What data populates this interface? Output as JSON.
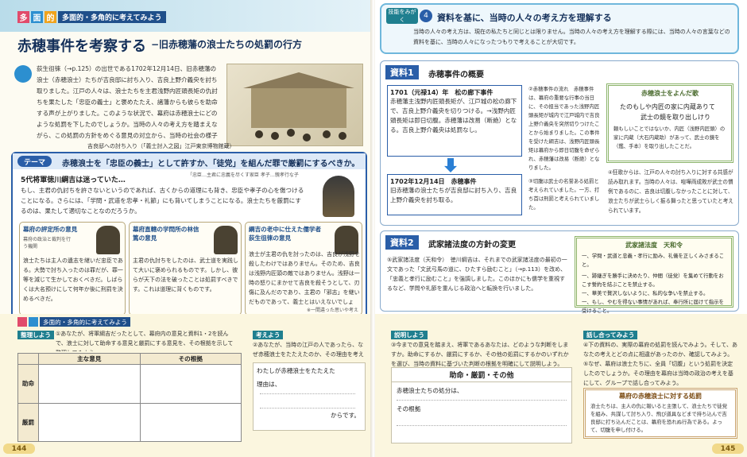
{
  "left": {
    "tag_label": "多面的・多角的に考えてみよう",
    "title": "赤穂事件を考察する",
    "subtitle": "−旧赤穂藩の浪士たちの処罰の行方",
    "intro_paragraph": "荻生徂徠（→p.125）の出世である1702年12月14日、旧赤穂藩の浪士（赤穂浪士）たちが吉良邸に討ち入り、吉良上野介義央を討ち取りました。江戸の人々は、浪士たちを主君浅野内匠頭長矩の仇討ちを果たした「忠臣の義士」と褒めたたえ、諸藩からも彼らを助命する声が上がりました。このような状況で、幕府は赤穂浪士にどのような処罰を下したのでしょうか。当時の人々の考え方を踏まえながら、この処罰の方針をめぐる意見の対立から、当時の社会の様子を多面的・多角的に考察してみよう。",
    "image_caption": "吉良邸への討ち入り（「義士討入之図」江戸東京博物館蔵）",
    "theme_label": "テーマ",
    "theme_text": "赤穂浪士を「忠臣の義士」として許すか、「徒党」を組んだ罪で厳罰にするべきか。",
    "opinion_main_title": "5代将軍徳川綱吉は迷っていた…",
    "opinion_main_text": "もし、主君の仇討ちを許さないというのであれば、古くからの道理にも背き、忠臣や孝子の心を傷つけることになる。さらには、「学問・武道を忠孝・礼節」にも背いてしまうことになる。浪士たちを厳罰にするのは、果たして適切なことなのだろうか。",
    "opinion_main_note": "「忠臣…主君に忠義を尽くす家臣 孝子…親孝行な子",
    "opinions": [
      {
        "name": "幕府の評定所の意見",
        "note": "幕府の政治と裁判を行う機関",
        "text": "浪士たちは主人の遺志を継いだ忠臣である。大勢で討ち入ったのは罪だが、罪一等を減じて生かしておくべきだ。しばらくは大名預けにして何年か後に刑罰を決めるべきだ。"
      },
      {
        "name": "幕府直轄の学問所の林信篤の意見",
        "note": "",
        "text": "主君の仇討ちをしたのは、武士道を実践して大いに褒められるものです。しかし、彼らが天下の法を破ったことは処罰すべきです。これは道理に背くものです。"
      },
      {
        "name": "綱吉の老中に仕えた儒学者荻生徂徠の意見",
        "note": "",
        "text": "浪士が主君の仇を討ったのは、吉良が浅野を殺したわけではありません。そのため、吉良は浅野内匠頭の敵ではありません。浅野は一時の怒りにまかせて吉良を殺そうとして、刃傷に及んだのであり、主君の「邪志」を継いだものであって、義士とはいえないでしょう。"
      }
    ],
    "opinion_footnote": "※一間違った思いや考え",
    "bottom_tag": "多面的・多角的に考えてみよう",
    "task1_label": "整理しよう",
    "task1_text": "①あなたが、将軍綱吉だったとして、幕府内の意見と資料1・2を読んで、浪士に対して助命する意見と厳罰にする意見を、その根拠を示して整理してみよう。",
    "table_headers": [
      "主な意見",
      "その根拠"
    ],
    "table_rows": [
      "助命",
      "厳罰"
    ],
    "task2_label": "考えよう",
    "task2_text": "②あなたが、当時の江戸の人であったら、なぜ赤穂浪士をたたえたのか、その理由を考えてみよう。",
    "fill_box_text1": "わたしが赤穂浪士をたたえた",
    "fill_box_text2": "理由は、",
    "fill_box_end": "からです。",
    "page_number": "144"
  },
  "right": {
    "skill_tag": "技能をみがく",
    "skill_number": "4",
    "skill_title": "資料を基に、当時の人々の考え方を理解する",
    "skill_text": "当時の人々の考え方は、現在の私たちと同じとは限りません。当時の人々の考え方を理解する際には、当時の人々の言葉などの資料を基に、当時の人々になったつもりで考えることが大切です。",
    "source1_label": "資料1",
    "source1_title": "赤穂事件の概要",
    "event1_date": "1701（元禄14）年　松の廊下事件",
    "event1_text": "赤穂藩主浅野内匠頭長矩が、江戸城の松の廊下で、吉良上野介義央を切りつける。→浅野内匠頭長矩は即日切腹。赤穂藩は改易（断絶）となる。吉良上野介義央は処罰なし。",
    "event2_date": "1702年12月14日　赤穂事件",
    "event2_text": "旧赤穂藩の浪士たちが吉良邸に討ち入り、吉良上野介義央を討ち取る。",
    "side_note1": "②赤穂事件の流れ　赤穂事件は、幕府の重要な行事の当日に、その担当であった浅野内匠頭長矩が城内で江戸城内で吉良上野介義央を突然切りつけたことから始まりました。この事件を受けた綱吉は、浅野内匠頭長矩は幕府から即日切腹を命ぜられ、赤穂藩は改易（断絶）となりました。",
    "side_note2": "③切腹は武士の名誉ある処罰と考えられていました。一方、打ち首は刑罰と考えられていました。",
    "poem_title": "赤穂浪士をよんだ歌",
    "poem_lines": [
      "たのもしや内匠の家に内蔵ありて",
      "武士の鏡を取り出しけり"
    ],
    "poem_note": "頼もしいことではないか、内匠（浅野内匠頭）の家に内蔵（大石内蔵助）があって、武士の鏡を（鑑、手本）を取り出したことだ。",
    "poem_desc": "④狂歌からは、江戸の人々の討ち入りに対する共感が読み取れます。当時の人々は、喧嘩両成敗が武士の慣例であるのに、吉良は切腹しなかったことに対して、浪士たちが武士らしく振る舞ったと思っていたと考えられています。",
    "source2_label": "資料2",
    "source2_title": "武家諸法度の方針の変更",
    "source2_text": "⑤武家諸法度（天和令）　徳川綱吉は、それまでの武家諸法度の最初の一文であった「文武弓馬の道に、ひたすら励むこと」（→p.113）を改め、「忠義と孝行に励むこと」を強調しました。このほかにも儒学を重視するなど、学問や礼節を重んじる政治へと転換を行いました。",
    "law_title": "武家諸法度",
    "law_sub": "天和令",
    "law_items": [
      "一、学問・武道と忠義・孝行に励み、礼儀を正しくみさまること。",
      "一、跡継ぎを勝手に決めたり、仲間（徒党）を集めて行動をおこす誓約を結ぶことを禁止する。",
      "一、華美で贅沢しないように、私的な争いを禁止する。",
      "一、もし、やむを得ない事情があれば、奉行所に届けて指示を受けること。"
    ],
    "task3_label": "説明しよう",
    "task3_text": "③今までの意見を踏まえ、将軍であるあなたは、どのような判断をしますか。助命にするか、厳罰にするか、その他の処罰にするかのいずれかを選び、当時の資料に基づいた判断の根拠を明確にして説明しよう。",
    "answer_header": "助命・厳罰・その他",
    "answer_line1": "赤穂浪士たちの処分は、",
    "answer_line2": "その根拠",
    "task4_label": "話し合ってみよう",
    "task4_text": "④下の資料の、実際の幕府の処罰を読んでみよう。そして、あなたの考えとどの点に相違があったのか、確認してみよう。⑤なぜ、幕府は浪士たちに、全員「切腹」という処罰を決定したのでしょうか。その理由を幕府は当時の政治の考えを基にして、グループで話し合ってみよう。",
    "verdict_title": "幕府の赤穂浪士に対する処罰",
    "verdict_text": "浪士たちは、主人の仇に報いると主張して、浪士たちで徒党を組み、共謀して討ち入り、飛び道具などまで持ち込んで吉良邸に打ち込んだことは、幕府を恐れぬ行為である。よって、切腹を申し付ける。",
    "page_number": "145"
  },
  "colors": {
    "navy": "#14305a",
    "theme_blue": "#2a5ea8",
    "pink": "#e6457a",
    "teal": "#1f7f8f"
  }
}
